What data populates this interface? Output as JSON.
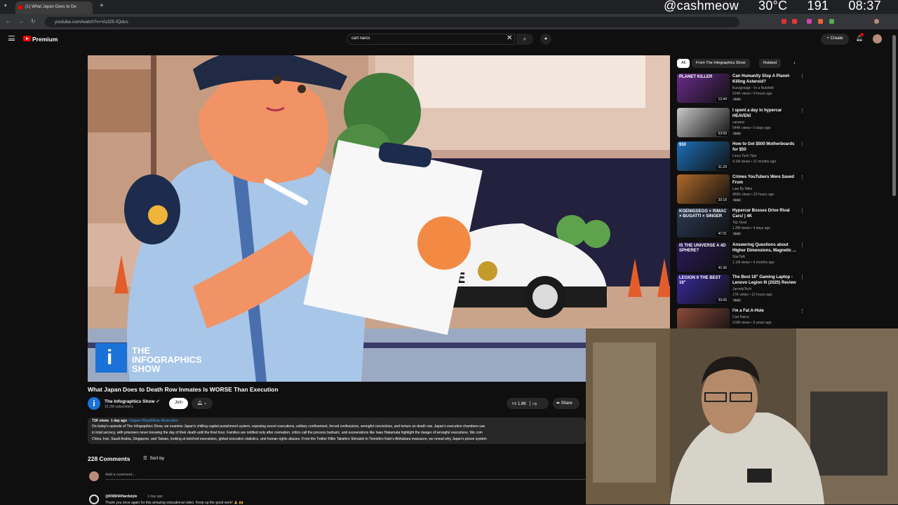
{
  "overlay": {
    "handle": "@cashmeow",
    "temperature": "30°C",
    "counter": "191",
    "clock": "08:37"
  },
  "browser": {
    "tab_title": "(1) What Japan Does to De",
    "url": "youtube.com/watch?v=Vu325-fQdus"
  },
  "header": {
    "logo": "Premium",
    "search_value": "cart narcs",
    "create": "Create"
  },
  "video": {
    "watermark": "THE\nINFOGRAPHICS\nSHOW",
    "title": "What Japan Does to Death Row Inmates Is WORSE Than Execution",
    "channel": "The Infographics Show",
    "subscribers": "15.2M subscribers",
    "join": "Join",
    "likes": "1.8K",
    "share": "Share"
  },
  "description": {
    "views": "71K views",
    "age": "1 day ago",
    "tags": "#Japan #DeathRow #Execution",
    "lines": [
      "On today's episode of The Infographics Show, we examine Japan's chilling capital punishment system, exposing secret executions, solitary confinement, forced confessions, wrongful convictions, and torture on death row. Japan's execution chambers use",
      "in total secrecy, with prisoners never knowing the day of their death until the final hour. Families are notified only after cremation, critics call the process barbaric, and exonerations like Iwao Hakamata highlight the danger of wrongful executions. We com",
      "China, Iran, Saudi Arabia, Singapore, and Taiwan, looking at botched executions, global execution statistics, and human rights abuses. From the Twitter Killer Takahiro Shiraishi to Tomohiro Kato's Akihabara massacre, we reveal why Japan's prison system"
    ]
  },
  "comments": {
    "count": "228 Comments",
    "sort": "Sort by",
    "add_placeholder": "Add a comment...",
    "first": {
      "author": "@KNSHAHardstyle",
      "time": "1 day ago",
      "text": "Thank you once again for this amazing educational video. Keep up the good work! 🙏 🙌"
    }
  },
  "sidebar": {
    "chips": [
      "All",
      "From The Infographics Show",
      "Related"
    ],
    "recs": [
      {
        "title": "Can Humanity Stop A Planet-Killing Asteroid?",
        "channel": "Kurzgesagt – In a Nutshell",
        "meta": "514K views • 9 hours ago",
        "badge": "New",
        "duration": "12:44",
        "thumb_text": "PLANET KILLER",
        "thumb_color": "#6a2b8c"
      },
      {
        "title": "I spent a day in hypercar HEAVEN!",
        "channel": "carwow",
        "meta": "544K views • 5 days ago",
        "badge": "New",
        "duration": "53:59",
        "thumb_text": "",
        "thumb_color": "#c8c8c8"
      },
      {
        "title": "How to Get $500 Motherboards for $50",
        "channel": "Linus Tech Tips",
        "meta": "4.1M views • 11 months ago",
        "badge": "",
        "duration": "31:29",
        "thumb_text": "$50",
        "thumb_color": "#1b6fb8"
      },
      {
        "title": "Crimes YouTubers Were Saved From",
        "channel": "Law By Mike",
        "meta": "465K views • 22 hours ago",
        "badge": "New",
        "duration": "20:18",
        "thumb_text": "",
        "thumb_color": "#b06a2a"
      },
      {
        "title": "Hypercar Bosses Drive Rival Cars! | 4K",
        "channel": "Top Gear",
        "meta": "1.2M views • 4 days ago",
        "badge": "New",
        "duration": "47:31",
        "thumb_text": "KOENIGSEGG × RIMAC × BUGATTI × SINGER",
        "thumb_color": "#2a3a56"
      },
      {
        "title": "Answering Questions about Higher Dimensions, Magnetic ...",
        "channel": "StarTalk",
        "meta": "1.1M views • 4 months ago",
        "badge": "",
        "duration": "41:36",
        "thumb_text": "IS THE UNIVERSE A 4D SPHERE?",
        "thumb_color": "#2b1a5c"
      },
      {
        "title": "The Best 18\" Gaming Laptop - Lenovo Legion 9i (2025) Review",
        "channel": "JarrodsTech",
        "meta": "17K views • 12 hours ago",
        "badge": "New",
        "duration": "20:06",
        "thumb_text": "LEGION 9 THE BEST 18\"",
        "thumb_color": "#3a2a9c"
      },
      {
        "title": "I'm a Fat A-Hole",
        "channel": "Cart Narcs",
        "meta": "3.5M views • 5 years ago",
        "badge": "",
        "duration": "",
        "thumb_text": "",
        "thumb_color": "#8a4a3a"
      }
    ]
  },
  "colors": {
    "background": "#0f0f0f",
    "accent": "#ff0000",
    "link": "#3ea6ff",
    "surface": "#272727"
  }
}
